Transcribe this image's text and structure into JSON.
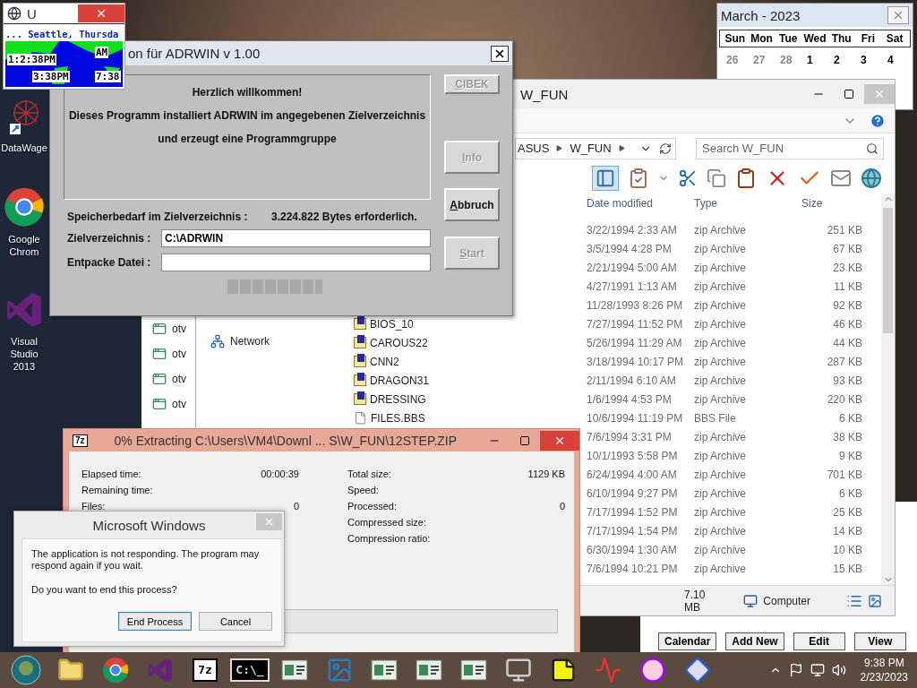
{
  "clock_widget": {
    "title": "U",
    "location": "... Seattle, Thursda",
    "times": [
      "1:2:38PM",
      "AM",
      "3:38PM",
      "7:38"
    ]
  },
  "desktop_icons": [
    {
      "label": "DataWage",
      "kind": "web"
    },
    {
      "label": "Google Chrom",
      "kind": "chrome"
    },
    {
      "label": "Visual Studio 2013",
      "kind": "vs"
    }
  ],
  "calendar": {
    "title": "March - 2023",
    "weekdays": [
      "Sun",
      "Mon",
      "Tue",
      "Wed",
      "Thu",
      "Fri",
      "Sat"
    ],
    "weeks": [
      [
        {
          "day": "26",
          "other_month": true,
          "selected": false
        },
        {
          "day": "27",
          "other_month": true,
          "selected": false
        },
        {
          "day": "28",
          "other_month": true,
          "selected": false
        },
        {
          "day": "1",
          "other_month": false,
          "selected": false
        },
        {
          "day": "2",
          "other_month": false,
          "selected": false
        },
        {
          "day": "3",
          "other_month": false,
          "selected": false
        },
        {
          "day": "4",
          "other_month": false,
          "selected": false
        }
      ]
    ]
  },
  "planner": {
    "buttons": [
      "Calendar",
      "Add New",
      "Edit",
      "View"
    ]
  },
  "side_list": {
    "items": [
      "otv",
      "otv",
      "otv",
      "otv"
    ]
  },
  "explorer": {
    "title": "W_FUN",
    "breadcrumb": [
      "ASUS",
      "W_FUN"
    ],
    "search": {
      "placeholder": "Search W_FUN"
    },
    "nav": [
      "Network"
    ],
    "columns": [
      "Date modified",
      "Type",
      "Size"
    ],
    "rows": [
      {
        "date": "3/22/1994 2:33 AM",
        "type": "zip Archive",
        "size": "251 KB"
      },
      {
        "date": "3/5/1994 4:28 PM",
        "type": "zip Archive",
        "size": "67 KB"
      },
      {
        "date": "2/21/1994 5:00 AM",
        "type": "zip Archive",
        "size": "23 KB"
      },
      {
        "date": "4/27/1991 1:13 AM",
        "type": "zip Archive",
        "size": "11 KB"
      },
      {
        "date": "11/28/1993 8:26 PM",
        "type": "zip Archive",
        "size": "92 KB"
      },
      {
        "kind": "zip",
        "name": "BIOS_10",
        "date": "7/27/1994 11:52 PM",
        "type": "zip Archive",
        "size": "46 KB"
      },
      {
        "kind": "zip",
        "name": "CAROUS22",
        "date": "5/26/1994 11:29 AM",
        "type": "zip Archive",
        "size": "44 KB"
      },
      {
        "kind": "zip",
        "name": "CNN2",
        "date": "3/18/1994 10:17 PM",
        "type": "zip Archive",
        "size": "287 KB"
      },
      {
        "kind": "zip",
        "name": "DRAGON31",
        "date": "2/11/1994 6:10 AM",
        "type": "zip Archive",
        "size": "93 KB"
      },
      {
        "kind": "zip",
        "name": "DRESSING",
        "date": "1/6/1994 4:53 PM",
        "type": "zip Archive",
        "size": "220 KB"
      },
      {
        "kind": "file",
        "name": "FILES.BBS",
        "date": "10/6/1994 11:19 PM",
        "type": "BBS File",
        "size": "6 KB"
      },
      {
        "date": "7/6/1994 3:31 PM",
        "type": "zip Archive",
        "size": "38 KB"
      },
      {
        "date": "10/1/1993 5:58 PM",
        "type": "zip Archive",
        "size": "9 KB"
      },
      {
        "date": "6/24/1994 4:00 AM",
        "type": "zip Archive",
        "size": "701 KB"
      },
      {
        "date": "6/10/1994 9:27 PM",
        "type": "zip Archive",
        "size": "6 KB"
      },
      {
        "date": "7/17/1994 1:52 PM",
        "type": "zip Archive",
        "size": "25 KB"
      },
      {
        "date": "7/17/1994 1:54 PM",
        "type": "zip Archive",
        "size": "14 KB"
      },
      {
        "date": "6/30/1994 1:30 AM",
        "type": "zip Archive",
        "size": "10 KB"
      },
      {
        "date": "7/6/1994 10:21 PM",
        "type": "zip Archive",
        "size": "15 KB"
      }
    ],
    "status": {
      "size": "7.10 MB",
      "location": "Computer"
    }
  },
  "installer": {
    "title": "on für ADRWIN v 1.00",
    "welcome": "Herzlich willkommen!",
    "lines": [
      "Dieses Programm installiert ADRWIN im angegebenen Zielverzeichnis",
      "und erzeugt eine Programmgruppe"
    ],
    "space_label": "Speicherbedarf im Zielverzeichnis :",
    "space_value": "3.224.822 Bytes erforderlich.",
    "fields": [
      {
        "label": "Zielverzeichnis :",
        "value": "C:\\ADRWIN"
      },
      {
        "label": "Entpacke Datei :"
      }
    ],
    "progress": {
      "level": 0
    },
    "buttons": [
      {
        "label": "CIBEK",
        "disabled": true
      },
      {
        "label": "Info",
        "disabled": true
      },
      {
        "label": "Abbruch",
        "disabled": false
      },
      {
        "label": "Start",
        "disabled": true
      }
    ]
  },
  "extract": {
    "badge": "7z",
    "title": "0% Extracting C:\\Users\\VM4\\Downl ... S\\W_FUN\\12STEP.ZIP",
    "left_stats": [
      {
        "label": "Elapsed time:",
        "value": "00:00:39"
      },
      {
        "label": "Remaining time:"
      },
      {
        "label": "Files:",
        "value": "0"
      }
    ],
    "right_stats": [
      {
        "label": "Total size:",
        "value": "1129 KB"
      },
      {
        "label": "Speed:"
      },
      {
        "label": "Processed:",
        "value": "0"
      },
      {
        "label": "Compressed size:"
      },
      {
        "label": "Compression ratio:"
      }
    ],
    "progress": {
      "level": 0
    }
  },
  "dialog": {
    "title": "Microsoft Windows",
    "message": "The application is not responding. The program may respond again if you wait.",
    "question": "Do you want to end this process?",
    "buttons": [
      {
        "label": "End Process",
        "selected": true
      },
      {
        "label": "Cancel",
        "selected": false
      }
    ]
  },
  "taskbar": {
    "apps": [
      {
        "kind": "orb"
      },
      {
        "kind": "explorer"
      },
      {
        "kind": "chrome"
      },
      {
        "kind": "vs"
      },
      {
        "kind": "sevenzip",
        "label": "7z"
      },
      {
        "kind": "console",
        "label": "C:\\_"
      },
      {
        "kind": "app"
      },
      {
        "kind": "photo"
      },
      {
        "kind": "app"
      },
      {
        "kind": "app"
      },
      {
        "kind": "app"
      },
      {
        "kind": "monitor"
      },
      {
        "kind": "note"
      },
      {
        "kind": "chart"
      },
      {
        "kind": "clock"
      },
      {
        "kind": "diamond"
      }
    ],
    "time": "9:38 PM",
    "date": "2/23/2023"
  }
}
